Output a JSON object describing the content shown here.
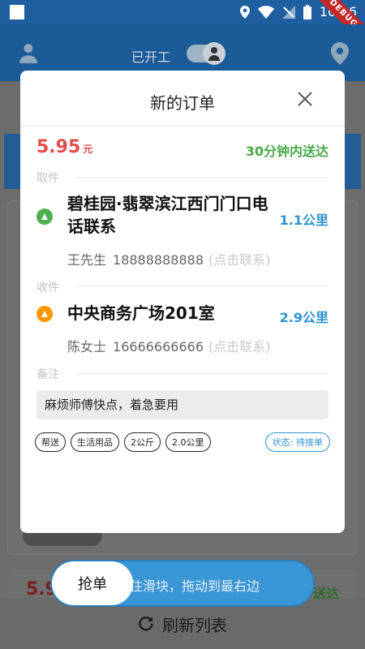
{
  "statusbar": {
    "time": "10:46",
    "debug_label": "DEBUG"
  },
  "header": {
    "work_status_label": "已开工"
  },
  "background": {
    "card2_price": "5.9",
    "card2_eta": "送达"
  },
  "slider": {
    "handle_label": "抢单",
    "hint": "住滑块，拖动到最右边"
  },
  "refresh": {
    "label": "刷新列表"
  },
  "modal": {
    "title": "新的订单",
    "price": "5.95",
    "price_unit": "元",
    "eta": "30分钟内送达",
    "pickup_label": "取件",
    "pickup": {
      "address": "碧桂园·翡翠滨江西门门口电话联系",
      "distance": "1.1公里",
      "name": "王先生",
      "phone": "18888888888",
      "hint": "(点击联系)",
      "marker": "A"
    },
    "delivery_label": "收件",
    "delivery": {
      "address": "中央商务广场201室",
      "distance": "2.9公里",
      "name": "陈女士",
      "phone": "16666666666",
      "hint": "(点击联系)",
      "marker": "A"
    },
    "note_label": "备注",
    "note": "麻烦师傅快点，着急要用",
    "tags": [
      "帮送",
      "生活用品",
      "2公斤",
      "2.0公里"
    ],
    "status": "状态: 待接单"
  },
  "colors": {
    "price": "#e24b4b",
    "eta": "#4aa84a",
    "distance": "#2e93d1",
    "slider": "#3a97d6"
  }
}
